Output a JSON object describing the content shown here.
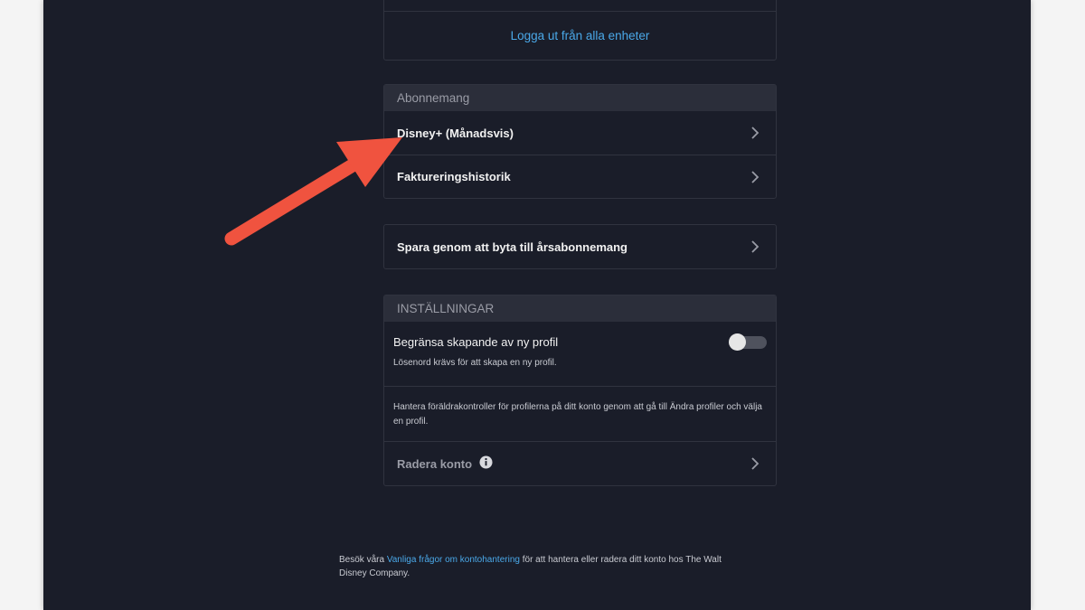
{
  "account": {
    "logout_all_label": "Logga ut från alla enheter"
  },
  "subscription": {
    "header": "Abonnemang",
    "plan_label": "Disney+ (Månadsvis)",
    "billing_history_label": "Faktureringshistorik"
  },
  "upgrade": {
    "label": "Spara genom att byta till årsabonnemang"
  },
  "settings": {
    "header": "INSTÄLLNINGAR",
    "restrict_profile_title": "Begränsa skapande av ny profil",
    "restrict_profile_desc": "Lösenord krävs för att skapa en ny profil.",
    "restrict_profile_enabled": false,
    "parental_info": "Hantera föräldrakontroller för profilerna på ditt konto genom att gå till Ändra profiler och välja en profil.",
    "delete_account_label": "Radera konto",
    "delete_account_info_icon": "info-circle-icon"
  },
  "footer": {
    "text_before": "Besök våra ",
    "link_text": "Vanliga frågor om kontohantering",
    "text_after": " för att hantera eller radera ditt konto hos The Walt Disney Company."
  },
  "annotation": {
    "arrow_color": "#f0533f",
    "arrow_icon": "arrow-annotation-icon"
  },
  "colors": {
    "background": "#1a1d29",
    "section_header": "#2b2e3a",
    "link": "#4aa8e8"
  }
}
